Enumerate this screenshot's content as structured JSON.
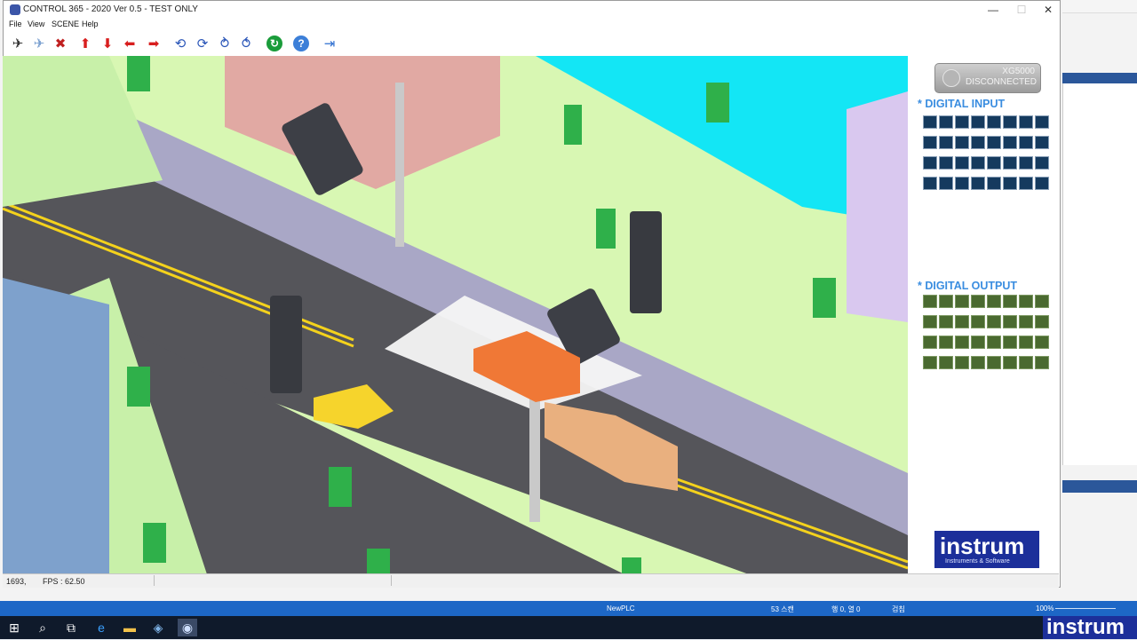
{
  "window": {
    "title": "CONTROL 365 - 2020 Ver 0.5 - TEST ONLY",
    "minimize": "—",
    "maximize": "☐",
    "close": "✕"
  },
  "menu": [
    "File",
    "View",
    "SCENE",
    "Help"
  ],
  "toolbar_icons": [
    {
      "name": "connect-icon",
      "glyph": "✈",
      "color": "#333"
    },
    {
      "name": "disconnect-icon",
      "glyph": "✈",
      "color": "#7aa0d0"
    },
    {
      "name": "stop-icon",
      "glyph": "✖",
      "color": "#c02020"
    },
    {
      "name": "arrow-up-icon",
      "glyph": "⬆",
      "color": "#d81e1e"
    },
    {
      "name": "arrow-down-icon",
      "glyph": "⬇",
      "color": "#d81e1e"
    },
    {
      "name": "arrow-left-icon",
      "glyph": "⬅",
      "color": "#d81e1e"
    },
    {
      "name": "arrow-right-icon",
      "glyph": "➡",
      "color": "#d81e1e"
    },
    {
      "name": "rotate-left-icon",
      "glyph": "⟲",
      "color": "#2b56b8"
    },
    {
      "name": "rotate-right-icon",
      "glyph": "⟳",
      "color": "#2b56b8"
    },
    {
      "name": "rotate-up-icon",
      "glyph": "⥁",
      "color": "#2b56b8"
    },
    {
      "name": "rotate-down-icon",
      "glyph": "⥀",
      "color": "#2b56b8"
    },
    {
      "name": "refresh-icon",
      "glyph": "↻",
      "color": "#1a9c3a"
    },
    {
      "name": "help-icon",
      "glyph": "?",
      "color": "#3c7fd8"
    },
    {
      "name": "exit-icon",
      "glyph": "⇥",
      "color": "#2f6fd0"
    }
  ],
  "panel": {
    "plc_line1": "XG5000",
    "plc_line2": "DISCONNECTED",
    "digital_input_title": "* DIGITAL INPUT",
    "digital_output_title": "* DIGITAL OUTPUT",
    "logo_main": "instrum",
    "logo_sub": "Instruments & Software"
  },
  "status": {
    "coords": "1693,",
    "fps": "FPS : 62.50"
  },
  "ide_status": {
    "project": "NewPLC",
    "scan": "53 스캔",
    "position": "행 0, 열 0",
    "mode": "검침",
    "zoom": "100%"
  },
  "taskbar": {
    "brand": "instrum"
  },
  "colors": {
    "accent_blue": "#3a8de0",
    "input_led": "#153a5e",
    "output_led": "#4a6a30",
    "sky": "#13e6f5",
    "grass": "#d8f7b3",
    "road": "#555559"
  }
}
